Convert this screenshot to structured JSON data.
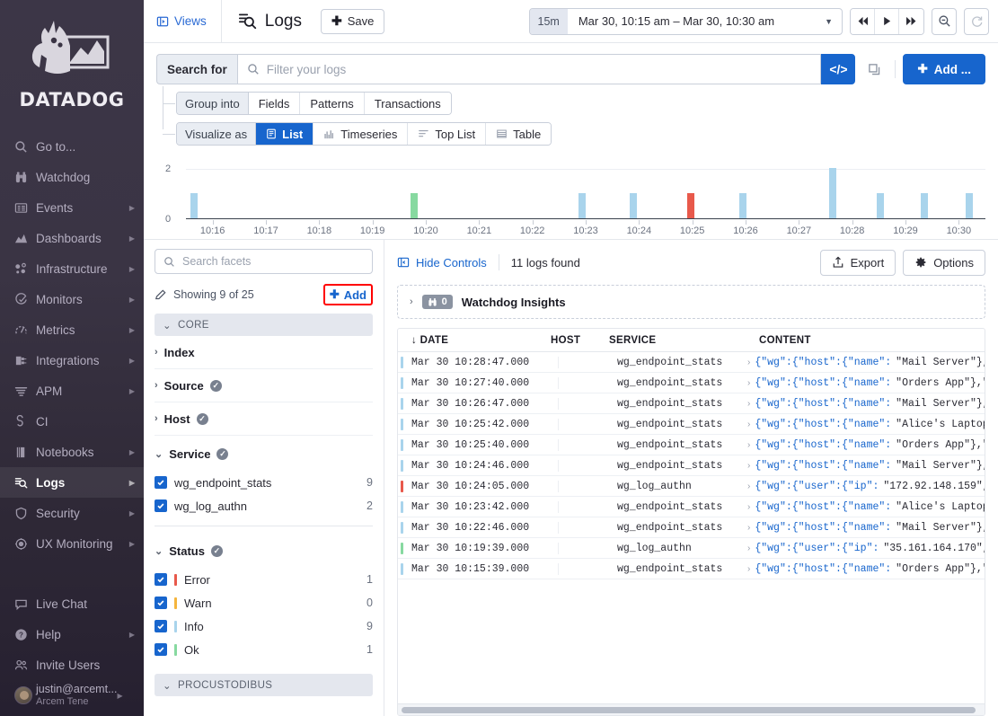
{
  "sidebar": {
    "brand": "DATADOG",
    "items": [
      {
        "label": "Go to...",
        "icon": "search-icon",
        "caret": false,
        "active": false
      },
      {
        "label": "Watchdog",
        "icon": "binoculars-icon",
        "caret": false,
        "active": false
      },
      {
        "label": "Events",
        "icon": "events-icon",
        "caret": true,
        "active": false
      },
      {
        "label": "Dashboards",
        "icon": "dashboards-icon",
        "caret": true,
        "active": false
      },
      {
        "label": "Infrastructure",
        "icon": "infrastructure-icon",
        "caret": true,
        "active": false
      },
      {
        "label": "Monitors",
        "icon": "monitors-icon",
        "caret": true,
        "active": false
      },
      {
        "label": "Metrics",
        "icon": "metrics-icon",
        "caret": true,
        "active": false
      },
      {
        "label": "Integrations",
        "icon": "integrations-icon",
        "caret": true,
        "active": false
      },
      {
        "label": "APM",
        "icon": "apm-icon",
        "caret": true,
        "active": false
      },
      {
        "label": "CI",
        "icon": "ci-icon",
        "caret": false,
        "active": false
      },
      {
        "label": "Notebooks",
        "icon": "notebooks-icon",
        "caret": true,
        "active": false
      },
      {
        "label": "Logs",
        "icon": "logs-icon",
        "caret": true,
        "active": true
      },
      {
        "label": "Security",
        "icon": "shield-icon",
        "caret": true,
        "active": false
      },
      {
        "label": "UX Monitoring",
        "icon": "ux-monitoring-icon",
        "caret": true,
        "active": false
      }
    ],
    "bottom_items": [
      {
        "label": "Live Chat",
        "icon": "chat-icon",
        "caret": false
      },
      {
        "label": "Help",
        "icon": "help-icon",
        "caret": true
      },
      {
        "label": "Invite Users",
        "icon": "users-icon",
        "caret": false
      }
    ],
    "user": {
      "email": "justin@arcemt...",
      "org": "Arcem Tene"
    }
  },
  "topbar": {
    "views_label": "Views",
    "page_title": "Logs",
    "save_label": "Save",
    "time": {
      "preset": "15m",
      "range": "Mar 30, 10:15 am – Mar 30, 10:30 am"
    },
    "nav_back_icon": "fast-rewind-icon",
    "nav_play_icon": "play-icon",
    "nav_forward_icon": "fast-forward-icon",
    "zoom_out_icon": "zoom-out-icon",
    "refresh_icon": "refresh-icon"
  },
  "search": {
    "label": "Search for",
    "value": "",
    "placeholder": "Filter your logs",
    "code_btn_label": "</>",
    "copy_icon": "copy-icon",
    "add_label": "Add ...",
    "group_into": {
      "label": "Group into",
      "options": [
        "Fields",
        "Patterns",
        "Transactions"
      ],
      "selected": null
    },
    "visualize_as": {
      "label": "Visualize as",
      "options": [
        {
          "label": "List",
          "icon": "list-icon"
        },
        {
          "label": "Timeseries",
          "icon": "timeseries-icon"
        },
        {
          "label": "Top List",
          "icon": "toplist-icon"
        },
        {
          "label": "Table",
          "icon": "table-icon"
        }
      ],
      "selected": "List"
    }
  },
  "chart_data": {
    "type": "bar",
    "title": "",
    "xlabel": "",
    "ylabel": "",
    "ylim": [
      0,
      2
    ],
    "ytick_labels": [
      "0",
      "2"
    ],
    "grid": true,
    "legend": null,
    "xtick_labels": [
      "10:16",
      "10:17",
      "10:18",
      "10:19",
      "10:20",
      "10:21",
      "10:22",
      "10:23",
      "10:24",
      "10:25",
      "10:26",
      "10:27",
      "10:28",
      "10:29",
      "10:30"
    ],
    "x_range": [
      "10:15",
      "10:30"
    ],
    "colors": {
      "info": "#a9d4ec",
      "ok": "#87d9a0",
      "error": "#e8594b",
      "warn": "#f5b53d"
    },
    "bars": [
      {
        "time": "10:15:39",
        "value": 1,
        "status": "info",
        "x_pct": 1.0
      },
      {
        "time": "10:19:39",
        "value": 1,
        "status": "ok",
        "x_pct": 28.5
      },
      {
        "time": "10:22:46",
        "value": 1,
        "status": "info",
        "x_pct": 49.6
      },
      {
        "time": "10:23:42",
        "value": 1,
        "status": "info",
        "x_pct": 56.0
      },
      {
        "time": "10:24:05",
        "value": 1,
        "status": "error",
        "x_pct": 63.1
      },
      {
        "time": "10:24:46",
        "value": 1,
        "status": "info",
        "x_pct": 69.7
      },
      {
        "time": "10:25:40",
        "value": 2,
        "status": "info",
        "x_pct": 80.9
      },
      {
        "time": "10:26:47",
        "value": 1,
        "status": "info",
        "x_pct": 86.8
      },
      {
        "time": "10:27:40",
        "value": 1,
        "status": "info",
        "x_pct": 92.4
      },
      {
        "time": "10:28:47",
        "value": 1,
        "status": "info",
        "x_pct": 98.0
      }
    ]
  },
  "facets": {
    "search_placeholder": "Search facets",
    "search_value": "",
    "edit_icon": "pencil-icon",
    "showing_text": "Showing 9 of 25",
    "add_label": "Add",
    "highlighted": "add-facet-button",
    "groups": [
      {
        "name": "CORE",
        "expanded": true,
        "facets": [
          {
            "label": "Index",
            "expanded": false,
            "has_check": false,
            "values": []
          },
          {
            "label": "Source",
            "expanded": false,
            "has_check": true,
            "values": []
          },
          {
            "label": "Host",
            "expanded": false,
            "has_check": true,
            "values": []
          },
          {
            "label": "Service",
            "expanded": true,
            "has_check": true,
            "values": [
              {
                "name": "wg_endpoint_stats",
                "count": "9",
                "checked": true,
                "color": null
              },
              {
                "name": "wg_log_authn",
                "count": "2",
                "checked": true,
                "color": null
              }
            ]
          },
          {
            "label": "Status",
            "expanded": true,
            "has_check": true,
            "values": [
              {
                "name": "Error",
                "count": "1",
                "checked": true,
                "color": "#e8594b"
              },
              {
                "name": "Warn",
                "count": "0",
                "checked": true,
                "color": "#f5b53d"
              },
              {
                "name": "Info",
                "count": "9",
                "checked": true,
                "color": "#a9d4ec"
              },
              {
                "name": "Ok",
                "count": "1",
                "checked": true,
                "color": "#87d9a0"
              }
            ]
          }
        ]
      },
      {
        "name": "PROCUSTODIBUS",
        "expanded": true,
        "facets": []
      }
    ]
  },
  "logs_panel": {
    "hide_controls_label": "Hide Controls",
    "logs_found": "11 logs found",
    "export_label": "Export",
    "options_label": "Options",
    "watchdog": {
      "title": "Watchdog Insights",
      "count": "0",
      "icon": "binoculars-icon"
    },
    "columns": [
      "DATE",
      "HOST",
      "SERVICE",
      "CONTENT"
    ],
    "sort_icon": "arrow-down-icon",
    "rows": [
      {
        "status": "info",
        "date": "Mar 30 10:28:47.000",
        "host": "",
        "service": "wg_endpoint_stats",
        "content_prefix": "{\"wg\":{\"host\":{\"name\":",
        "content_value": "\"Mail Server\"},\"…"
      },
      {
        "status": "info",
        "date": "Mar 30 10:27:40.000",
        "host": "",
        "service": "wg_endpoint_stats",
        "content_prefix": "{\"wg\":{\"host\":{\"name\":",
        "content_value": "\"Orders App\"},\"e…"
      },
      {
        "status": "info",
        "date": "Mar 30 10:26:47.000",
        "host": "",
        "service": "wg_endpoint_stats",
        "content_prefix": "{\"wg\":{\"host\":{\"name\":",
        "content_value": "\"Mail Server\"},\"…"
      },
      {
        "status": "info",
        "date": "Mar 30 10:25:42.000",
        "host": "",
        "service": "wg_endpoint_stats",
        "content_prefix": "{\"wg\":{\"host\":{\"name\":",
        "content_value": "\"Alice's Laptop\"…"
      },
      {
        "status": "info",
        "date": "Mar 30 10:25:40.000",
        "host": "",
        "service": "wg_endpoint_stats",
        "content_prefix": "{\"wg\":{\"host\":{\"name\":",
        "content_value": "\"Orders App\"},\"e…"
      },
      {
        "status": "info",
        "date": "Mar 30 10:24:46.000",
        "host": "",
        "service": "wg_endpoint_stats",
        "content_prefix": "{\"wg\":{\"host\":{\"name\":",
        "content_value": "\"Mail Server\"},\"…"
      },
      {
        "status": "error",
        "date": "Mar 30 10:24:05.000",
        "host": "",
        "service": "wg_log_authn",
        "content_prefix": "{\"wg\":{\"user\":{\"ip\":",
        "content_value": "\"172.92.148.159\",\"…"
      },
      {
        "status": "info",
        "date": "Mar 30 10:23:42.000",
        "host": "",
        "service": "wg_endpoint_stats",
        "content_prefix": "{\"wg\":{\"host\":{\"name\":",
        "content_value": "\"Alice's Laptop\"…"
      },
      {
        "status": "info",
        "date": "Mar 30 10:22:46.000",
        "host": "",
        "service": "wg_endpoint_stats",
        "content_prefix": "{\"wg\":{\"host\":{\"name\":",
        "content_value": "\"Mail Server\"},\"…"
      },
      {
        "status": "ok",
        "date": "Mar 30 10:19:39.000",
        "host": "",
        "service": "wg_log_authn",
        "content_prefix": "{\"wg\":{\"user\":{\"ip\":",
        "content_value": "\"35.161.164.170\",\"…"
      },
      {
        "status": "info",
        "date": "Mar 30 10:15:39.000",
        "host": "",
        "service": "wg_endpoint_stats",
        "content_prefix": "{\"wg\":{\"host\":{\"name\":",
        "content_value": "\"Orders App\"},\"e…"
      }
    ]
  }
}
